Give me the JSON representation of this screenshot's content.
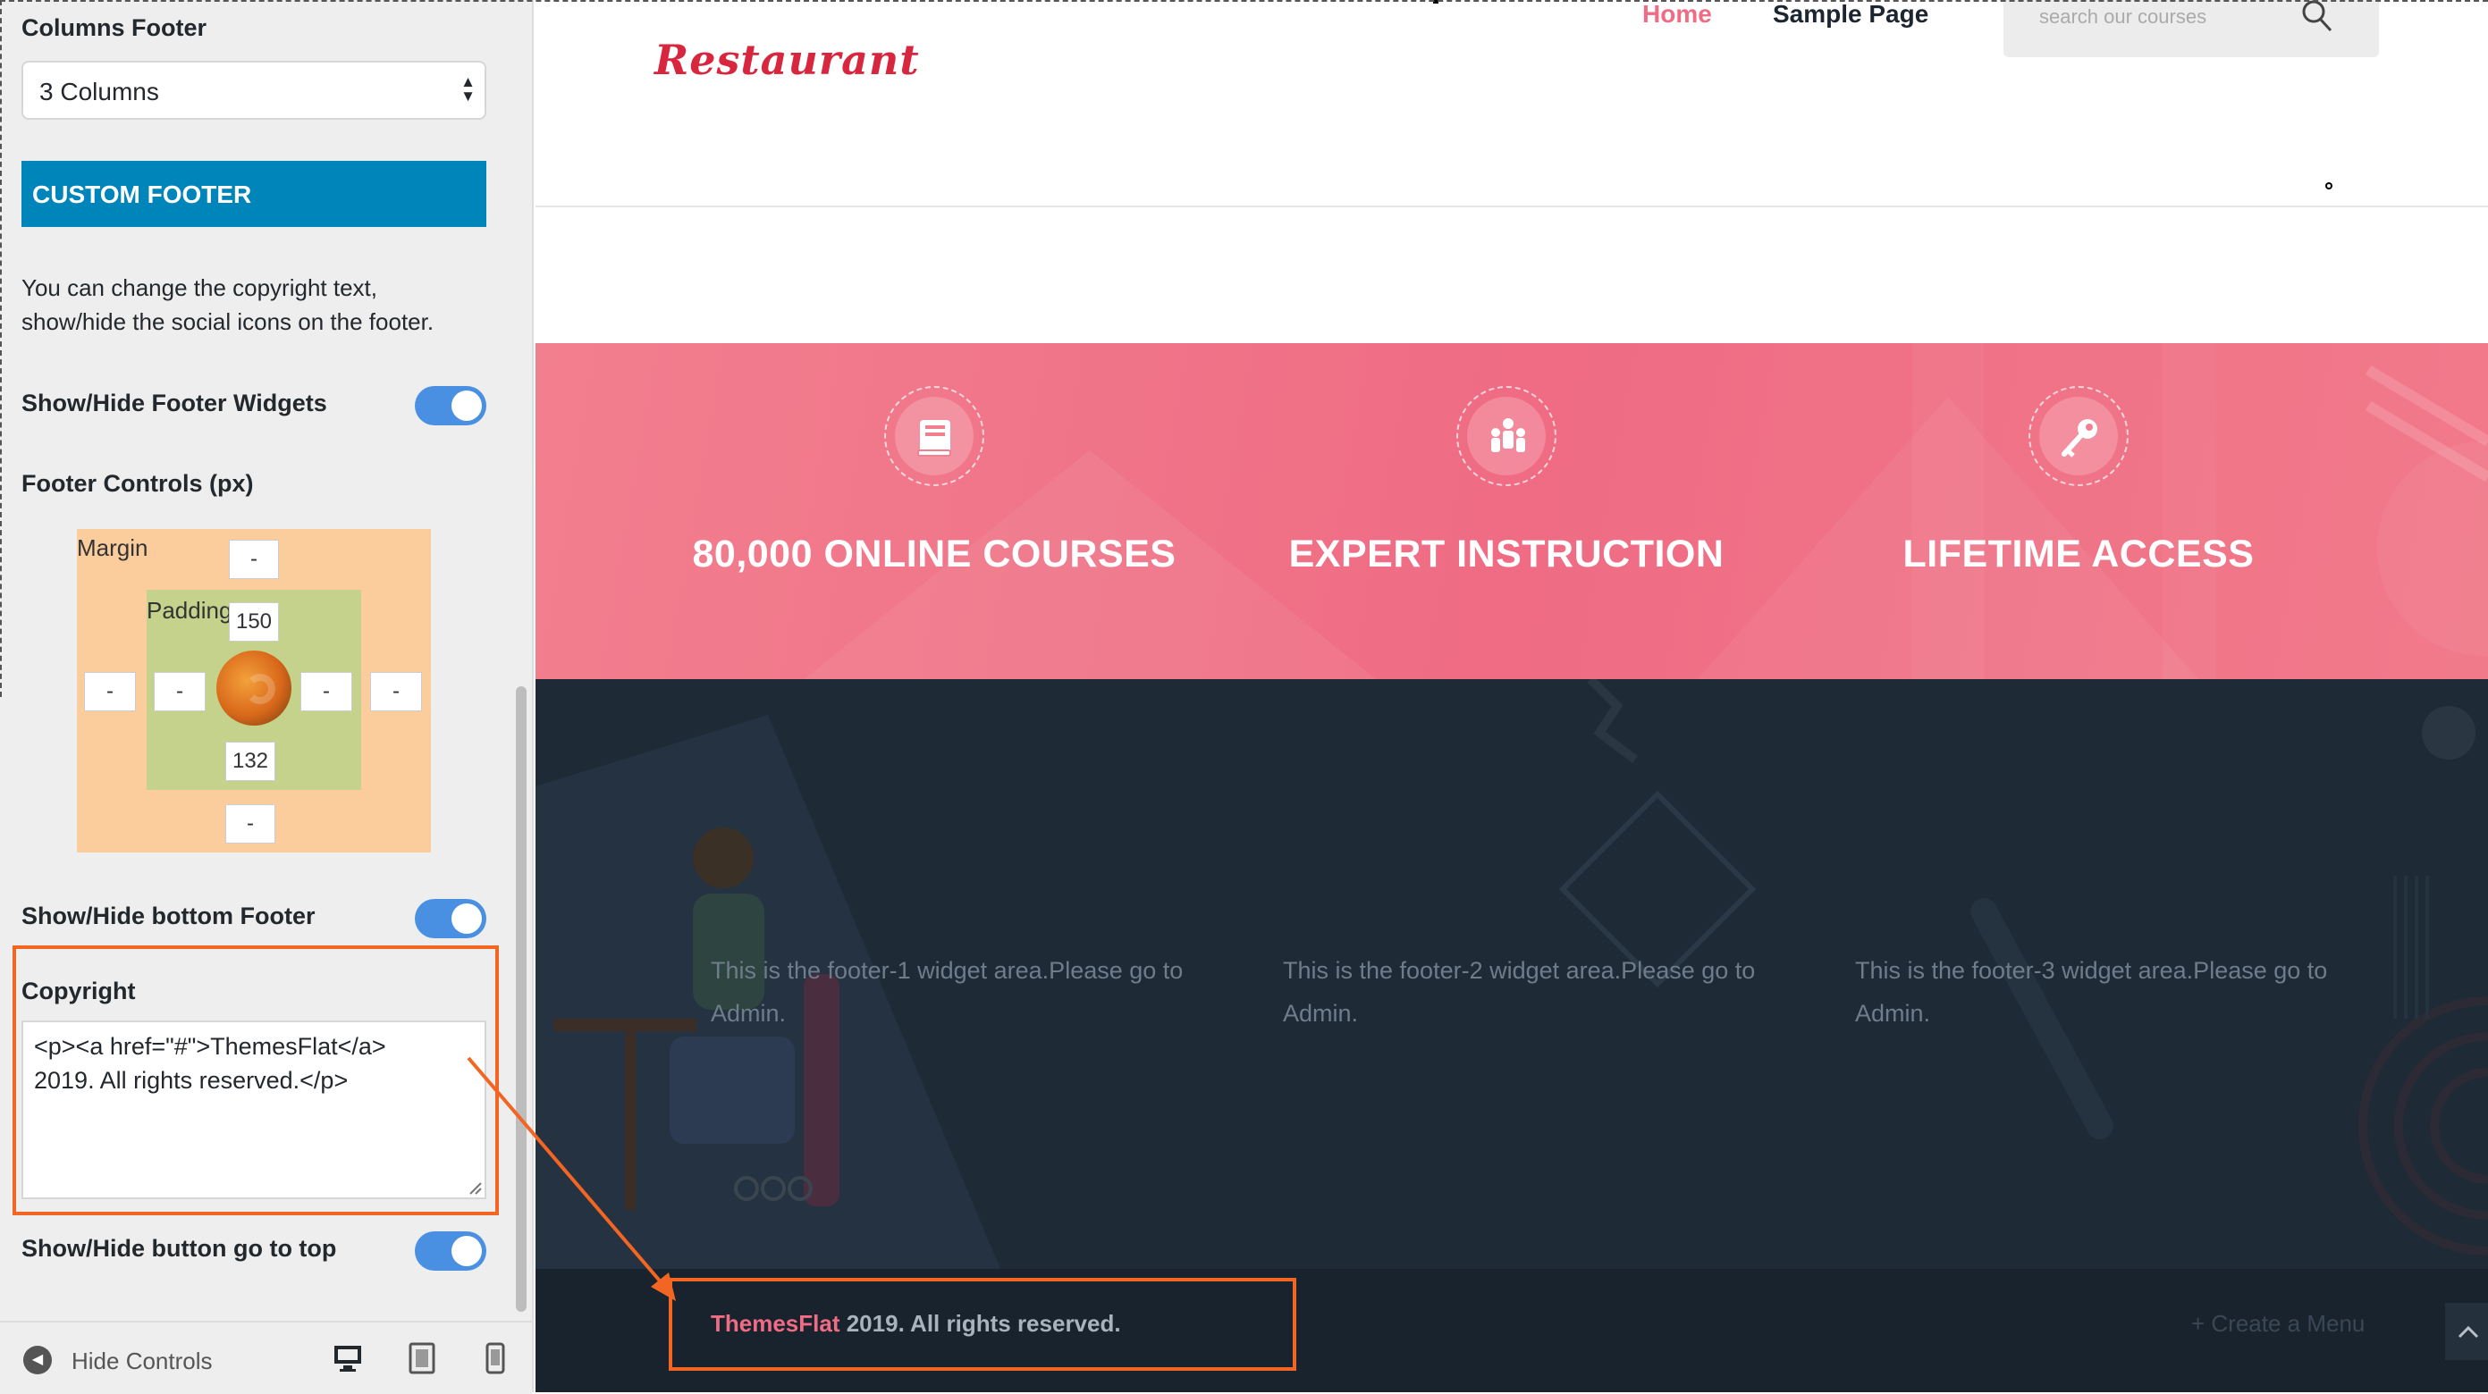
{
  "customizer": {
    "columns_footer_label": "Columns Footer",
    "columns_footer_value": "3 Columns",
    "section_title": "CUSTOM FOOTER",
    "description": "You can change the copyright text, show/hide the social icons on the footer.",
    "show_footer_widgets_label": "Show/Hide Footer Widgets",
    "footer_controls_label": "Footer Controls (px)",
    "box_model": {
      "margin_label": "Margin",
      "padding_label": "Padding",
      "margin_top": "-",
      "margin_left": "-",
      "margin_right": "-",
      "margin_bottom": "-",
      "padding_top": "150",
      "padding_left": "-",
      "padding_right": "-",
      "padding_bottom": "132"
    },
    "show_bottom_footer_label": "Show/Hide bottom Footer",
    "copyright_label": "Copyright",
    "copyright_value": "<p><a href=\"#\">ThemesFlat</a>\n2019. All rights reserved.</p>",
    "show_go_top_label": "Show/Hide button go to top",
    "hide_controls_label": "Hide Controls",
    "toggles": {
      "footer_widgets": true,
      "bottom_footer": true,
      "go_top": true
    }
  },
  "preview": {
    "logo": "Restaurant",
    "nav": [
      "Home",
      "Sample Page"
    ],
    "search_placeholder": "search our courses",
    "features": [
      {
        "icon": "book-icon",
        "title": "80,000 ONLINE COURSES"
      },
      {
        "icon": "team-icon",
        "title": "EXPERT INSTRUCTION"
      },
      {
        "icon": "key-icon",
        "title": "LIFETIME ACCESS"
      }
    ],
    "widgets": [
      "This is the footer-1 widget area.Please go to Admin.",
      "This is the footer-2 widget area.Please go to Admin.",
      "This is the footer-3 widget area.Please go to Admin."
    ],
    "copyright_link": "ThemesFlat",
    "copyright_rest": " 2019. All rights reserved.",
    "footer_menu": "+ Create a Menu"
  },
  "colors": {
    "accent_blue": "#0085ba",
    "pink": "#ef6c84",
    "dark": "#1e2a36",
    "highlight": "#f26522"
  }
}
